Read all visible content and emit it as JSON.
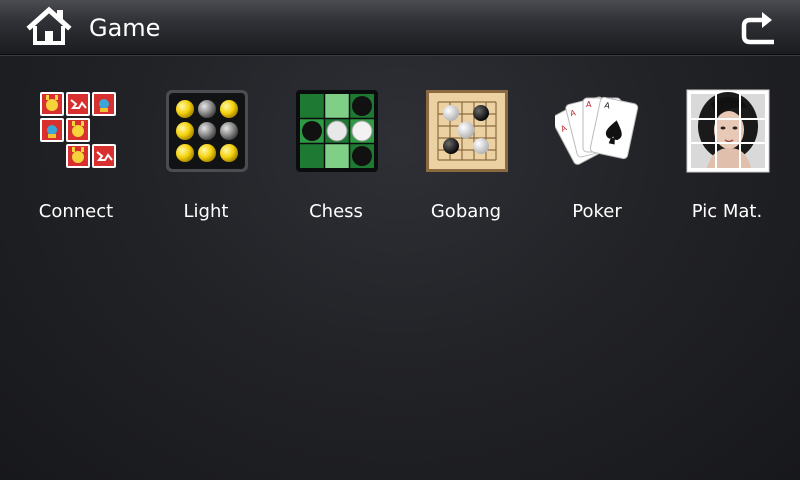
{
  "header": {
    "title": "Game",
    "home_icon": "home-icon",
    "back_icon": "return-icon"
  },
  "apps": [
    {
      "label": "Connect",
      "icon": "connect-icon"
    },
    {
      "label": "Light",
      "icon": "light-icon"
    },
    {
      "label": "Chess",
      "icon": "chess-icon"
    },
    {
      "label": "Gobang",
      "icon": "gobang-icon"
    },
    {
      "label": "Poker",
      "icon": "poker-icon"
    },
    {
      "label": "Pic Mat.",
      "icon": "picture-match-icon"
    }
  ],
  "colors": {
    "background": "#1d1e22",
    "header": "#2f3136",
    "text": "#ffffff"
  }
}
